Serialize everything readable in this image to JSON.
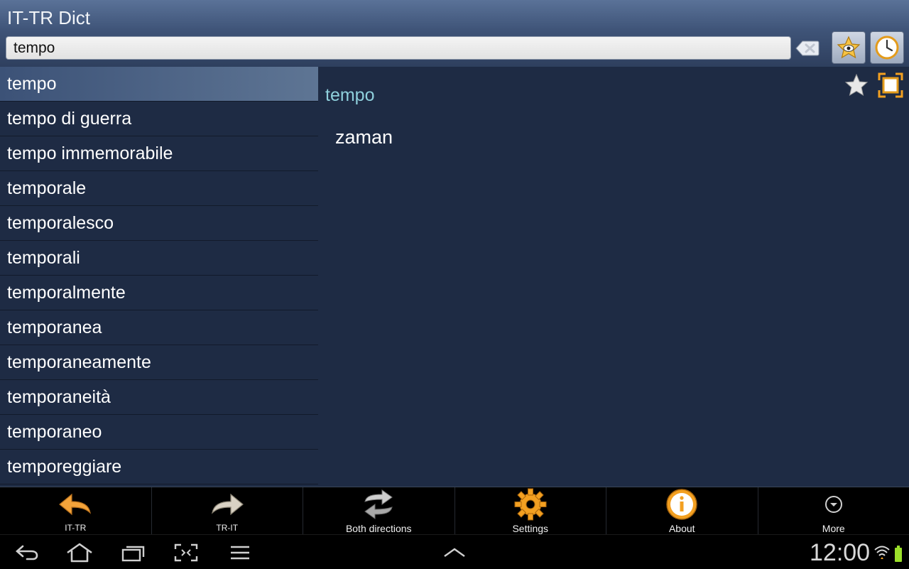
{
  "app": {
    "title": "IT-TR Dict"
  },
  "search": {
    "value": "tempo",
    "placeholder": ""
  },
  "word_list": [
    "tempo",
    "tempo di guerra",
    "tempo immemorabile",
    "temporale",
    "temporalesco",
    "temporali",
    "temporalmente",
    "temporanea",
    "temporaneamente",
    "temporaneità",
    "temporaneo",
    "temporeggiare"
  ],
  "selected_index": 0,
  "detail": {
    "word": "tempo",
    "translation": "zaman"
  },
  "toolbar": [
    {
      "label": "IT-TR",
      "icon": "arrow-left-icon"
    },
    {
      "label": "TR-IT",
      "icon": "arrow-right-icon"
    },
    {
      "label": "Both directions",
      "icon": "swap-icon"
    },
    {
      "label": "Settings",
      "icon": "gear-icon"
    },
    {
      "label": "About",
      "icon": "info-icon"
    },
    {
      "label": "More",
      "icon": "chevron-down-icon"
    }
  ],
  "status": {
    "time": "12:00"
  },
  "colors": {
    "header": "#3f5478",
    "background": "#1e2b44",
    "accent_word": "#8fd0dc",
    "icon_orange": "#f3a021"
  }
}
